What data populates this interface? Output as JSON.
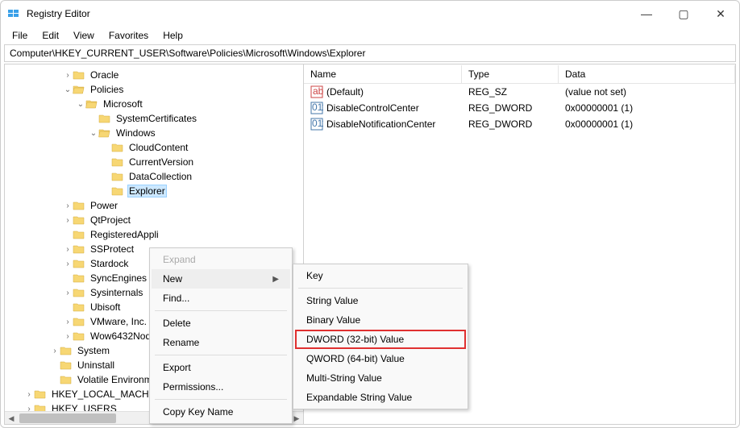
{
  "window": {
    "title": "Registry Editor"
  },
  "menubar": [
    "File",
    "Edit",
    "View",
    "Favorites",
    "Help"
  ],
  "address": "Computer\\HKEY_CURRENT_USER\\Software\\Policies\\Microsoft\\Windows\\Explorer",
  "tree": {
    "nodes": [
      {
        "indent": 2,
        "twisty": ">",
        "label": "Oracle"
      },
      {
        "indent": 2,
        "twisty": "v",
        "label": "Policies"
      },
      {
        "indent": 3,
        "twisty": "v",
        "label": "Microsoft"
      },
      {
        "indent": 4,
        "twisty": "",
        "label": "SystemCertificates"
      },
      {
        "indent": 4,
        "twisty": "v",
        "label": "Windows"
      },
      {
        "indent": 5,
        "twisty": "",
        "label": "CloudContent"
      },
      {
        "indent": 5,
        "twisty": "",
        "label": "CurrentVersion"
      },
      {
        "indent": 5,
        "twisty": "",
        "label": "DataCollection"
      },
      {
        "indent": 5,
        "twisty": "",
        "label": "Explorer",
        "selected": true
      },
      {
        "indent": 2,
        "twisty": ">",
        "label": "Power"
      },
      {
        "indent": 2,
        "twisty": ">",
        "label": "QtProject"
      },
      {
        "indent": 2,
        "twisty": "",
        "label": "RegisteredAppli"
      },
      {
        "indent": 2,
        "twisty": ">",
        "label": "SSProtect"
      },
      {
        "indent": 2,
        "twisty": ">",
        "label": "Stardock"
      },
      {
        "indent": 2,
        "twisty": "",
        "label": "SyncEngines"
      },
      {
        "indent": 2,
        "twisty": ">",
        "label": "Sysinternals"
      },
      {
        "indent": 2,
        "twisty": "",
        "label": "Ubisoft"
      },
      {
        "indent": 2,
        "twisty": ">",
        "label": "VMware, Inc."
      },
      {
        "indent": 2,
        "twisty": ">",
        "label": "Wow6432Node"
      },
      {
        "indent": 1,
        "twisty": ">",
        "label": "System"
      },
      {
        "indent": 1,
        "twisty": "",
        "label": "Uninstall"
      },
      {
        "indent": 1,
        "twisty": "",
        "label": "Volatile Environment"
      },
      {
        "indent": 0,
        "twisty": ">",
        "label": "HKEY_LOCAL_MACHINE",
        "rootIndent": true
      },
      {
        "indent": 0,
        "twisty": ">",
        "label": "HKEY_USERS",
        "rootIndent": true
      }
    ]
  },
  "list": {
    "headers": {
      "name": "Name",
      "type": "Type",
      "data": "Data"
    },
    "rows": [
      {
        "icon": "sz",
        "name": "(Default)",
        "type": "REG_SZ",
        "data": "(value not set)"
      },
      {
        "icon": "dw",
        "name": "DisableControlCenter",
        "type": "REG_DWORD",
        "data": "0x00000001 (1)"
      },
      {
        "icon": "dw",
        "name": "DisableNotificationCenter",
        "type": "REG_DWORD",
        "data": "0x00000001 (1)"
      }
    ]
  },
  "contextMenu1": {
    "items": [
      {
        "label": "Expand",
        "disabled": true
      },
      {
        "label": "New",
        "submenu": true,
        "hover": true
      },
      {
        "label": "Find...",
        "sepAfter": true
      },
      {
        "label": "Delete"
      },
      {
        "label": "Rename",
        "sepAfter": true
      },
      {
        "label": "Export"
      },
      {
        "label": "Permissions...",
        "sepAfter": true
      },
      {
        "label": "Copy Key Name"
      }
    ]
  },
  "contextMenu2": {
    "items": [
      {
        "label": "Key",
        "sepAfter": true
      },
      {
        "label": "String Value"
      },
      {
        "label": "Binary Value"
      },
      {
        "label": "DWORD (32-bit) Value",
        "highlighted": true
      },
      {
        "label": "QWORD (64-bit) Value"
      },
      {
        "label": "Multi-String Value"
      },
      {
        "label": "Expandable String Value"
      }
    ]
  }
}
